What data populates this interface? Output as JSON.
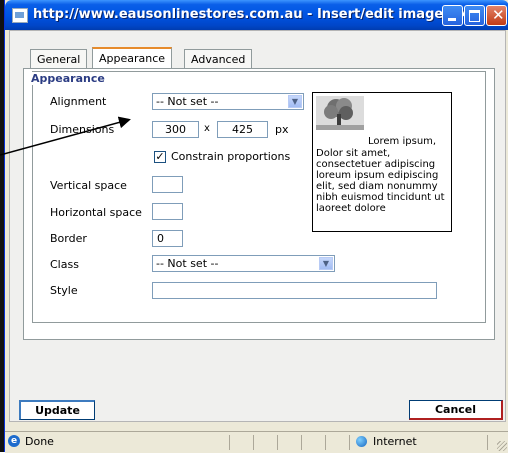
{
  "window": {
    "title": "http://www.eausonlinestores.com.au - Insert/edit image - Mi..."
  },
  "tabs": [
    {
      "label": "General",
      "active": false
    },
    {
      "label": "Appearance",
      "active": true
    },
    {
      "label": "Advanced",
      "active": false
    }
  ],
  "appearance": {
    "legend": "Appearance",
    "alignment": {
      "label": "Alignment",
      "value": "-- Not set --"
    },
    "dimensions": {
      "label": "Dimensions",
      "width": "300",
      "separator": "x",
      "height": "425",
      "unit": "px"
    },
    "constrain": {
      "label": "Constrain proportions",
      "checked": true
    },
    "vertical_space": {
      "label": "Vertical space",
      "value": ""
    },
    "horizontal_space": {
      "label": "Horizontal space",
      "value": ""
    },
    "border": {
      "label": "Border",
      "value": "0"
    },
    "class": {
      "label": "Class",
      "value": "-- Not set --"
    },
    "style": {
      "label": "Style",
      "value": ""
    }
  },
  "preview": {
    "first_line": "Lorem ipsum,",
    "text": "Dolor sit amet, consectetuer adipiscing loreum ipsum edipiscing elit, sed diam nonummy nibh euismod tincidunt ut laoreet dolore"
  },
  "buttons": {
    "update": "Update",
    "cancel": "Cancel"
  },
  "statusbar": {
    "status": "Done",
    "zone": "Internet"
  },
  "colors": {
    "titlebar": "#0054e3",
    "tab_accent": "#e68b2c",
    "legend": "#2b3c83"
  }
}
